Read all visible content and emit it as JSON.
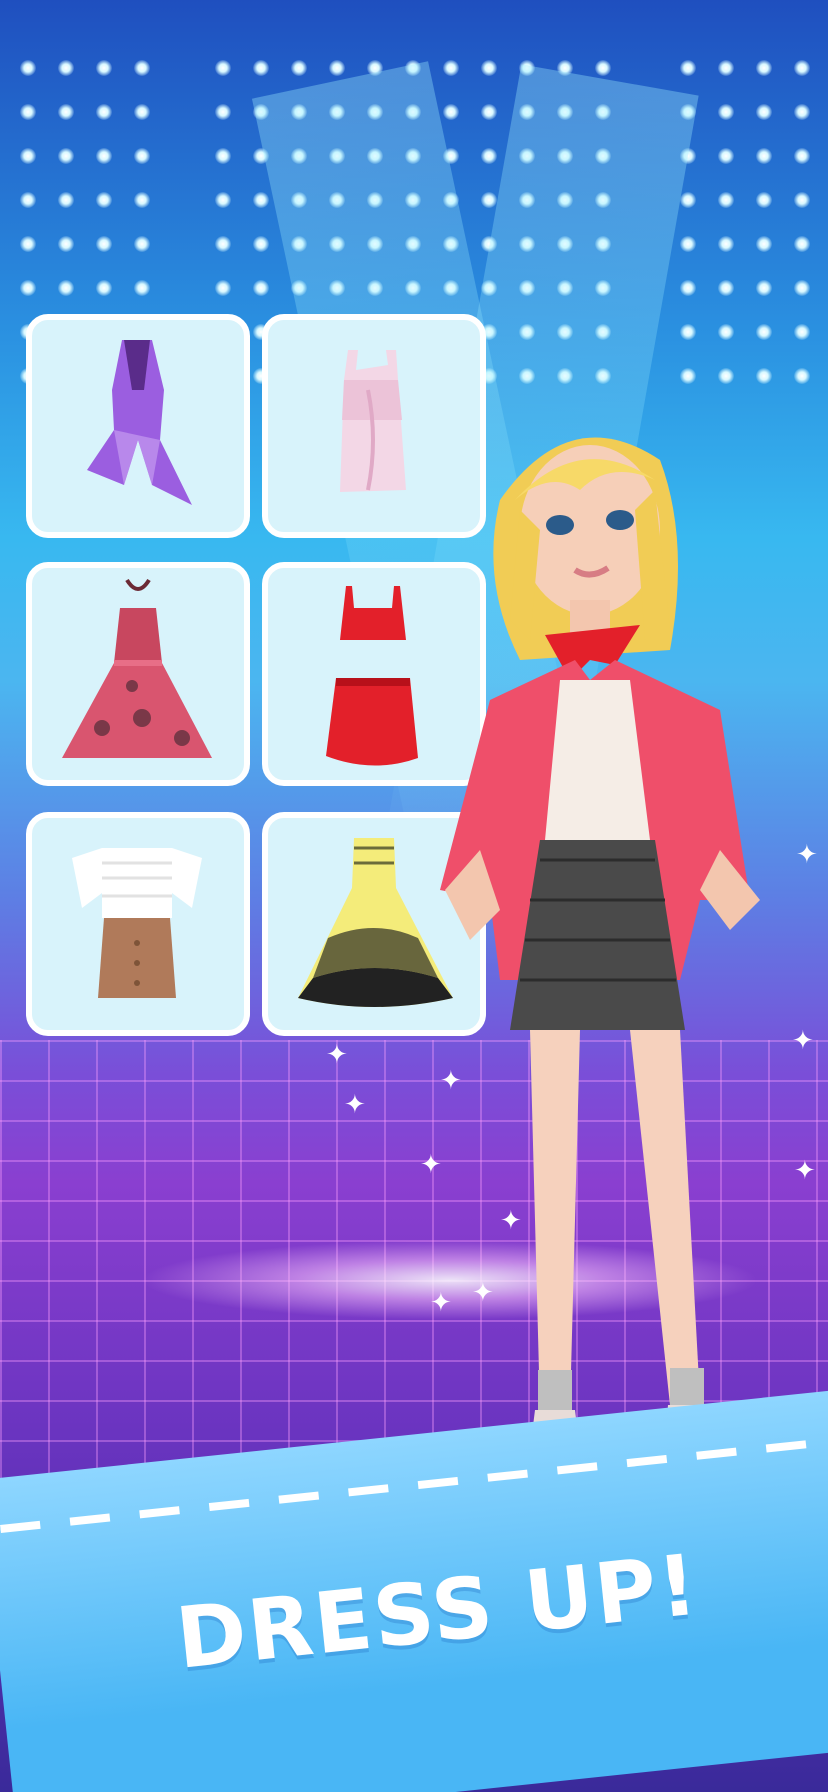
{
  "banner": {
    "title": "DRESS UP!"
  },
  "outfits": [
    {
      "name": "purple-halter-dress",
      "colors": [
        "#9b5ee0",
        "#5a2c8a"
      ]
    },
    {
      "name": "pink-satin-mini-dress",
      "colors": [
        "#f3d7e6",
        "#e6b7cf"
      ]
    },
    {
      "name": "red-floral-skater-dress",
      "colors": [
        "#d9556f",
        "#a83248"
      ]
    },
    {
      "name": "red-crop-top-and-skirt",
      "colors": [
        "#e3202a",
        "#b8101a"
      ]
    },
    {
      "name": "white-top-and-brown-skirt",
      "colors": [
        "#ffffff",
        "#b07a5a"
      ]
    },
    {
      "name": "yellow-black-tie-dye-gown",
      "colors": [
        "#f4ec7a",
        "#222222"
      ]
    }
  ],
  "colors": {
    "card_bg": "#d8f3fb",
    "card_border": "#ffffff",
    "banner_bg": "#5ec2f7"
  }
}
